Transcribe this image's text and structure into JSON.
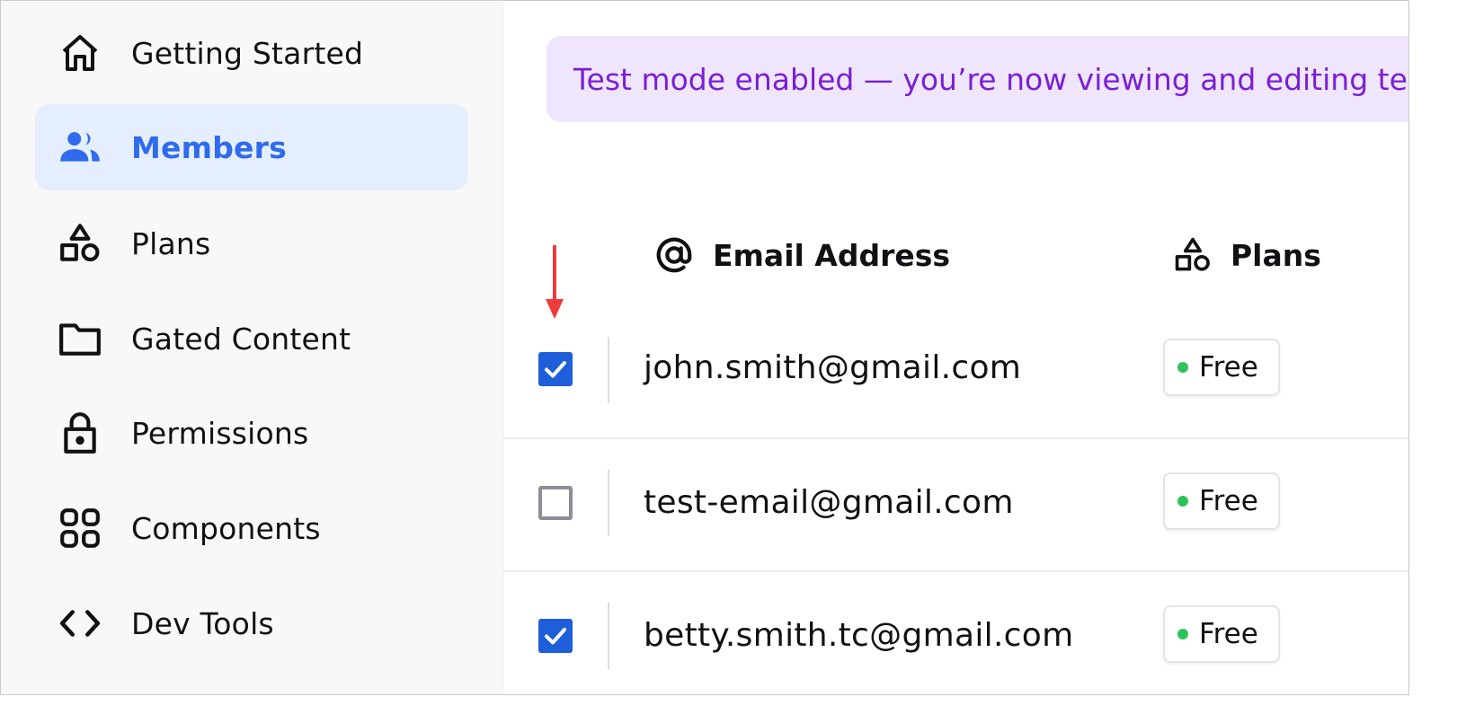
{
  "sidebar": {
    "items": [
      {
        "label": "Getting Started",
        "icon": "home-icon",
        "active": false
      },
      {
        "label": "Members",
        "icon": "users-icon",
        "active": true
      },
      {
        "label": "Plans",
        "icon": "shapes-icon",
        "active": false
      },
      {
        "label": "Gated Content",
        "icon": "folder-icon",
        "active": false
      },
      {
        "label": "Permissions",
        "icon": "lock-icon",
        "active": false
      },
      {
        "label": "Components",
        "icon": "components-icon",
        "active": false
      },
      {
        "label": "Dev Tools",
        "icon": "code-icon",
        "active": false
      }
    ],
    "active_color": "#2f6bec",
    "active_bg": "#e5eefc"
  },
  "banner": {
    "text": "Test mode enabled — you’re now viewing and editing tes",
    "text_color": "#7a1fd6",
    "bg_color": "#efe6fb"
  },
  "table": {
    "columns": [
      {
        "label": "Email Address",
        "icon": "at-sign-icon"
      },
      {
        "label": "Plans",
        "icon": "shapes-icon"
      }
    ],
    "rows": [
      {
        "email": "john.smith@gmail.com",
        "checked": true,
        "plan": "Free"
      },
      {
        "email": "test-email@gmail.com",
        "checked": false,
        "plan": "Free"
      },
      {
        "email": "betty.smith.tc@gmail.com",
        "checked": true,
        "plan": "Free"
      }
    ],
    "checkbox_color": "#1e5fd9",
    "plan_dot_color": "#2fc25b"
  },
  "annotation": {
    "arrow_icon": "down-arrow-icon",
    "arrow_color": "#ee3b3b"
  }
}
